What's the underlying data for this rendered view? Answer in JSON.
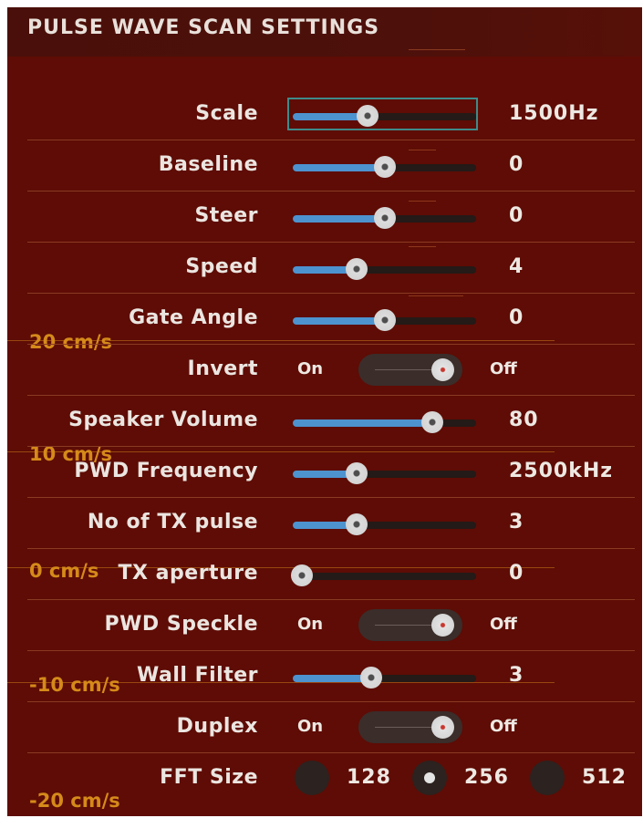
{
  "header": {
    "title": "PULSE WAVE SCAN SETTINGS"
  },
  "rows": [
    {
      "label": "Scale",
      "value": "1500Hz",
      "level": 0.41
    },
    {
      "label": "Baseline",
      "value": "0",
      "level": 0.5
    },
    {
      "label": "Steer",
      "value": "0",
      "level": 0.5
    },
    {
      "label": "Speed",
      "value": "4",
      "level": 0.35
    },
    {
      "label": "Gate Angle",
      "value": "0",
      "level": 0.5
    },
    {
      "label": "Invert",
      "on": "On",
      "off": "Off",
      "state": "Off"
    },
    {
      "label": "Speaker Volume",
      "value": "80",
      "level": 0.76
    },
    {
      "label": "PWD Frequency",
      "value": "2500kHz",
      "level": 0.35
    },
    {
      "label": "No of TX pulse",
      "value": "3",
      "level": 0.35
    },
    {
      "label": "TX aperture",
      "value": "0",
      "level": 0.05
    },
    {
      "label": "PWD Speckle",
      "on": "On",
      "off": "Off",
      "state": "Off"
    },
    {
      "label": "Wall Filter",
      "value": "3",
      "level": 0.43
    },
    {
      "label": "Duplex",
      "on": "On",
      "off": "Off",
      "state": "Off"
    },
    {
      "label": "FFT Size",
      "options": [
        "128",
        "256",
        "512"
      ],
      "selected": "256"
    }
  ],
  "background_scale": [
    "20 cm/s",
    "10 cm/s",
    "0 cm/s",
    "-10 cm/s",
    "-20 cm/s"
  ],
  "colors": {
    "panel": "#5e0c05",
    "accent": "#4d93cf",
    "scale": "#d58a1a"
  }
}
